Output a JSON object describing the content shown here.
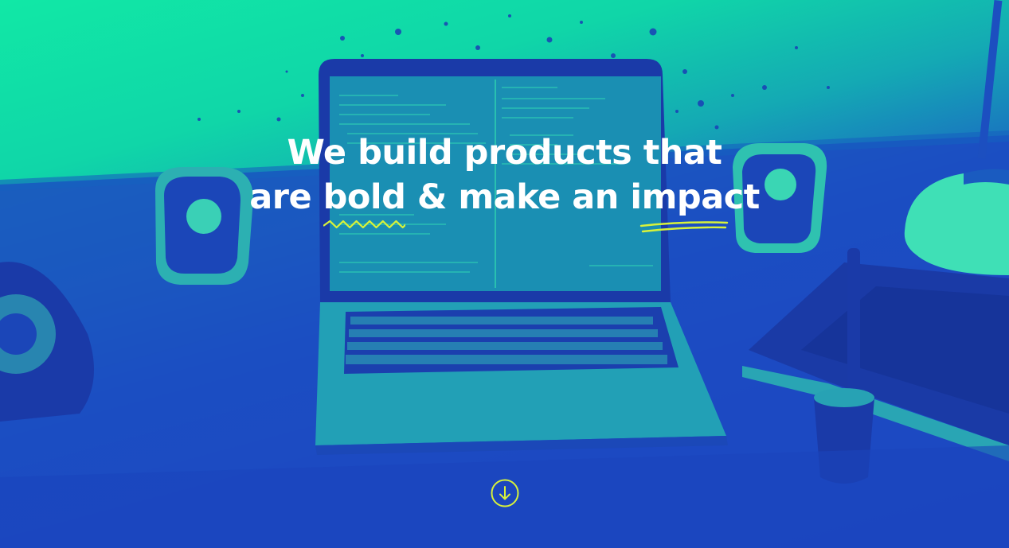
{
  "hero": {
    "headline_line1": "We build products that",
    "headline_line2_part1": "are ",
    "headline_word_bold": "bold",
    "headline_line2_part2": " & make an ",
    "headline_word_impact": "impact"
  },
  "scroll_button": {
    "icon": "arrow-down-circle-icon",
    "aria_label": "Scroll down"
  },
  "colors": {
    "gradient_top": "#11e8a6",
    "gradient_bottom": "#1b46c0",
    "accent": "#d8f23a",
    "headline_text": "#ffffff"
  }
}
